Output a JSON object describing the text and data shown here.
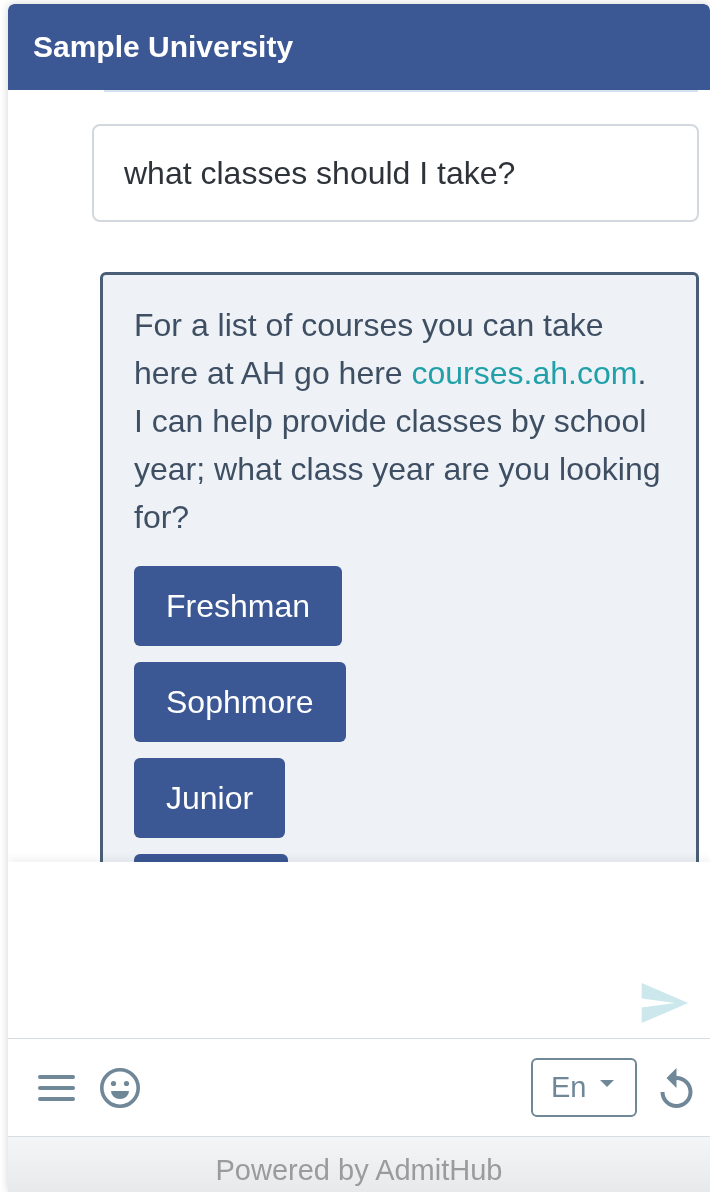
{
  "header": {
    "title": "Sample University"
  },
  "messages": [
    {
      "kind": "user",
      "text": "what classes should I take?"
    },
    {
      "kind": "bot",
      "parts": [
        {
          "kind": "text",
          "text": "For a list of courses you can take here at AH go here "
        },
        {
          "kind": "link",
          "text": "courses.ah.com"
        },
        {
          "kind": "text",
          "text": ". I can help provide classes by school year; what class year are you looking for?"
        }
      ],
      "options": [
        {
          "kind": "button",
          "label": "Freshman"
        },
        {
          "kind": "button",
          "label": "Sophmore"
        },
        {
          "kind": "button",
          "label": "Junior"
        },
        {
          "kind": "cut_off"
        }
      ]
    }
  ],
  "composer": {
    "send_button": {
      "disabled": true
    }
  },
  "toolbar": {
    "language": "En"
  },
  "footer": {
    "text": "Powered by AdmitHub"
  }
}
